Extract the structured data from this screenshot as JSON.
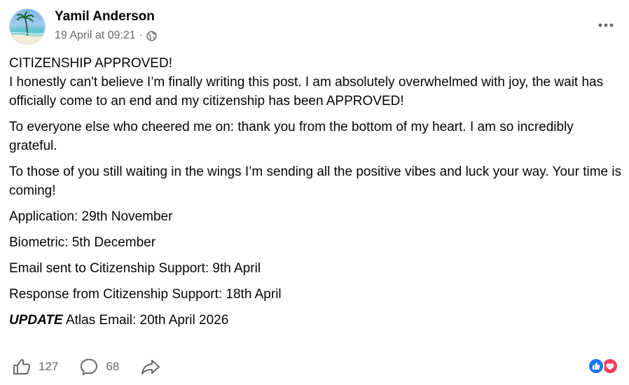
{
  "post": {
    "author": "Yamil Anderson",
    "timestamp": "19 April at 09:21",
    "separator": "·",
    "privacy_icon": "globe-icon",
    "more_icon": "more-options-icon",
    "headline": "CITIZENSHIP APPROVED!",
    "paragraphs": [
      "I honestly can't believe I’m finally writing this post. I am absolutely overwhelmed with joy, the wait has officially come to an end and my citizenship has been APPROVED!",
      "To everyone else who cheered me on: thank you from the bottom of my heart. I am so incredibly grateful.",
      "To those of you still waiting in the wings I’m sending all the positive vibes and luck your way. Your time is coming!",
      "Application: 29th November",
      "Biometric: 5th December",
      "Email sent to Citizenship Support: 9th April",
      "Response from Citizenship Support: 18th April"
    ],
    "update_label": "UPDATE",
    "update_text": " Atlas Email: 20th April 2026"
  },
  "footer": {
    "likes": "127",
    "comments": "68",
    "icons": {
      "like": "like-icon",
      "comment": "comment-icon",
      "share": "share-icon",
      "reactions": [
        "like-reaction-icon",
        "love-reaction-icon"
      ]
    }
  },
  "colors": {
    "text": "#050505",
    "secondary": "#65676b",
    "like_blue": "#1877f2",
    "love_red": "#f33e58"
  }
}
